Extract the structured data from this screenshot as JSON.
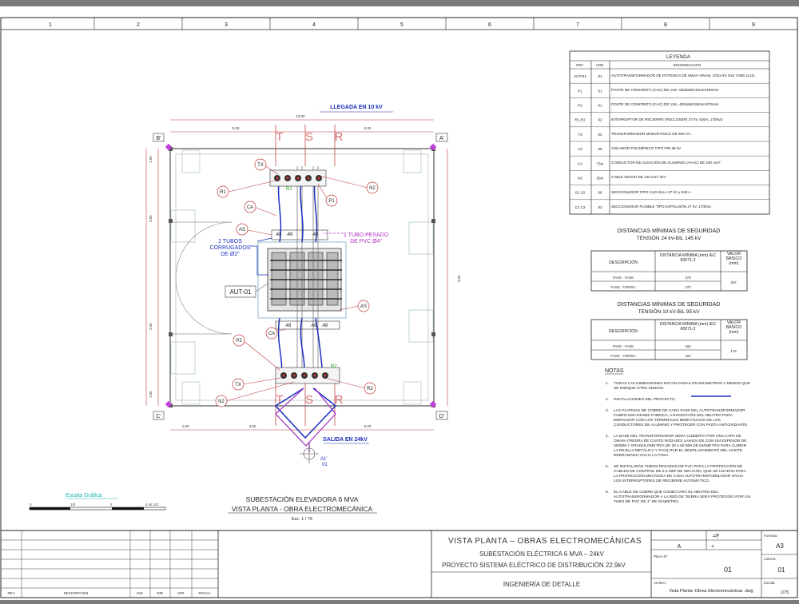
{
  "frame": {
    "column_numbers": [
      "1",
      "2",
      "3",
      "4",
      "5",
      "6",
      "7",
      "8",
      "9"
    ]
  },
  "plan": {
    "arrival_label": "LLEGADA EN 10 kV",
    "departure_label": "SALIDA EN 24kV",
    "corner_labels": [
      "B'",
      "A'",
      "C'",
      "D'"
    ],
    "phases_top": [
      "T",
      "S",
      "R"
    ],
    "phases_bottom": [
      "T",
      "S",
      "R"
    ],
    "dim_total": "10.00",
    "dim_top": [
      "5.00",
      "5.00"
    ],
    "dim_bottom": [
      "1.00",
      "3.60",
      "5.00"
    ],
    "dim_left": [
      "1.50",
      "3.50",
      "3.50",
      "1.50"
    ],
    "dim_right": [
      "9.00"
    ],
    "callouts": [
      "TX",
      "R1",
      "CA",
      "AS",
      "P1",
      "N2",
      "AS",
      "CA",
      "P2",
      "TX",
      "N2",
      "R2"
    ],
    "conduits_note": [
      "2 TUBOS",
      "CORRUGADOS",
      "DE Ø2\""
    ],
    "pvc_note": [
      "1 TUBO PESADO",
      "DE PVC Ø4\""
    ],
    "transformer_tag": "AUT-01",
    "bushing_labels": [
      ".48",
      ".48",
      ".48",
      ".48",
      ".48",
      ".48"
    ],
    "green_labels": [
      "R1",
      "R2"
    ],
    "section_ref": [
      "A1'",
      "01"
    ],
    "title": "SUBESTACIÓN ELEVADORA 6 MVA",
    "subtitle": "VISTA PLANTA - OBRA ELECTROMECÁNICA",
    "scale": "Esc. 1 / 75"
  },
  "graphic_scale": {
    "title": "Escala Gráfica",
    "ticks": [
      "0",
      "1/3",
      "2",
      "4 mt  1/3"
    ]
  },
  "legend": {
    "title": "LEYENDA",
    "headers": [
      "REF.",
      "UND.",
      "DENOMINACIÓN"
    ],
    "rows": [
      {
        "ref": "AUT-01",
        "und": "01",
        "desc": "AUTOTRANSFORMADOR DE POTENCIA DE 6MVA–ONAN, 10/24 kV Dx5 YN5D (±11)."
      },
      {
        "ref": "P1",
        "und": "01",
        "desc": "POSTE DE CONCRETO (CAC) DE 13m. 500daN/210mm/405mm"
      },
      {
        "ref": "P2",
        "und": "01",
        "desc": "POSTE DE CONCRETO (CAC) DE 13m. 400daN/150mm/375mm"
      },
      {
        "ref": "R1,R2",
        "und": "02",
        "desc": "INTERRUPTOR DE RECIERRE (RECLOSER) 27 kV, 630A, 170kVp"
      },
      {
        "ref": "TX",
        "und": "02",
        "desc": "TRANSFORMADOR MONOFÁSICO DE 500 VA."
      },
      {
        "ref": "AS",
        "und": "06",
        "desc": "AISLADOR POLIMÉRICO TIPO PIN 36 kV"
      },
      {
        "ref": "CA",
        "und": "75m",
        "desc": "CONDUCTOR DE ALEACIÓN DE ALUMINIO (AAAC) DE 240 mm²"
      },
      {
        "ref": "N2",
        "und": "35m",
        "desc": "CABLE N2XOH DE 120 mm² 1kV"
      },
      {
        "ref": "S1 S2",
        "und": "06",
        "desc": "SECCIONADOR TIPO CUCHILLA 27 kV y 630 A."
      },
      {
        "ref": "C1 C2",
        "und": "02",
        "desc": "SECCIONADOR FUSIBLE TIPO EXPULSIÓN 27 kV, 170kVp"
      }
    ]
  },
  "safety_24": {
    "title": "DISTANCIAS MÍNIMAS DE SEGURIDAD",
    "subtitle": "TENSIÓN 24 kV-BIL 145 kV",
    "headers": [
      "DESCRIPCIÓN",
      "DISTANCIA MÍNIMA (mm) IEC 60071-2",
      "VALOR BÁSICO (mm)"
    ],
    "rows": [
      [
        "FASE - FASE",
        "270"
      ],
      [
        "FASE - TIERRA",
        "270"
      ]
    ],
    "basic": "297"
  },
  "safety_10": {
    "title": "DISTANCIAS MÍNIMAS DE SEGURIDAD",
    "subtitle": "TENSIÓN 10 kV-BIL 95 kV",
    "headers": [
      "DESCRIPCIÓN",
      "DISTANCIA MÍNIMA (mm) IEC 60071-2",
      "VALOR BÁSICO (mm)"
    ],
    "rows": [
      [
        "FASE - FASE",
        "160"
      ],
      [
        "FASE - TIERRA",
        "160"
      ]
    ],
    "basic": "176"
  },
  "notes": {
    "title": "NOTAS",
    "items": [
      {
        "num": "1.",
        "lines": [
          "TODAS LAS DIMENSIONES ESTÁN DADAS EN MILÍMETROS A MENOS QUE",
          "SE INDIQUE OTRA UNIDAD."
        ]
      },
      {
        "num": "2.",
        "lines": [
          "INSTALACIONES DEL PROYECTO."
        ]
      },
      {
        "num": "3.",
        "lines": [
          "LAS PLATINAS DE COBRE DE CADA FASE DEL AUTOTRANSFORMADOR",
          "FABRICADO DESDE FÁBRICA, A EXCEPCIÓN DEL NEUTRO PARA",
          "EMPALMAR CON LOS TERMINALES BIMETÁLICOS DE LOS",
          "CONDUCTORES DE ALUMINIO Y PROTEGER CON PASTA ANTIOXIDANTE."
        ]
      },
      {
        "num": "4.",
        "lines": [
          "LA BASE DEL TRANSFORMADOR SERÁ CUBIERTA POR UNA CAPA DE",
          "ONAVA (PIEDRA DE CANTO RODADO) LAVADA DE CON UN ESPESOR DE",
          "300MM Y GRANULOMETRÍA DE 30 A 60 MM DE DIÁMETRO PARA CUBRIR",
          "LA REJILLA METÁLICA Y FACILITAR EL DESPLAZAMIENTO DEL ACEITE",
          "DERRAMADO HACIA LA FOSA."
        ]
      },
      {
        "num": "5.",
        "lines": [
          "SE INSTALARÁN TUBOS PESADOS DE PVC PARA LA PROTECCIÓN DE",
          "CABLES DE CONTROL DE 2.5 MM² DE SECCIÓN, QUE SE USARÁN PARA",
          "LA PROTECCIÓN MECÁNICA DE CADA AUTOTRANSFORMADOR HACIA",
          "LOS INTERRUPTORES DE RECIERRE AUTOMÁTICO."
        ]
      },
      {
        "num": "6.",
        "lines": [
          "EL CABLE DE COBRE QUE CONECTARÁ EL NEUTRO DEL",
          "AUTOTRANSFORMADOR A LA RED DE TIERRA SERÁ PROTEGIDO POR UN",
          "TUBO DE PVC DE 1\" DE DIÁMETRO."
        ]
      }
    ]
  },
  "title_block": {
    "rev_headers": [
      "REV",
      "DESCRIPCIÓN",
      "DIS",
      "DIB",
      "APR",
      "FECHA"
    ],
    "main_title": "VISTA PLANTA – OBRAS ELECTROMECÁNICAS",
    "sub1": "SUBESTACIÓN ELÉCTRICA 6 MVA – 24kV",
    "sub2": "PROYECTO   SISTEMA ELÉCTRICO DE DISTRIBUCIÓN 22.9kV",
    "eng": "INGENIERÍA DE DETALLE",
    "cell_a": "A",
    "cell_f": "=F",
    "cell_plus": "+",
    "plano_label": "Plano Nº",
    "plano_value": "01",
    "archivo_label": "Archivo:",
    "archivo_value": "Vista Planta–Obras Electromecánicas .dwg",
    "formato_label": "Formato:",
    "formato_value": "A3",
    "lamina_label": "Lámina:",
    "lamina_value": "01",
    "escala_label": "Escala:",
    "escala_value": "1/75"
  }
}
